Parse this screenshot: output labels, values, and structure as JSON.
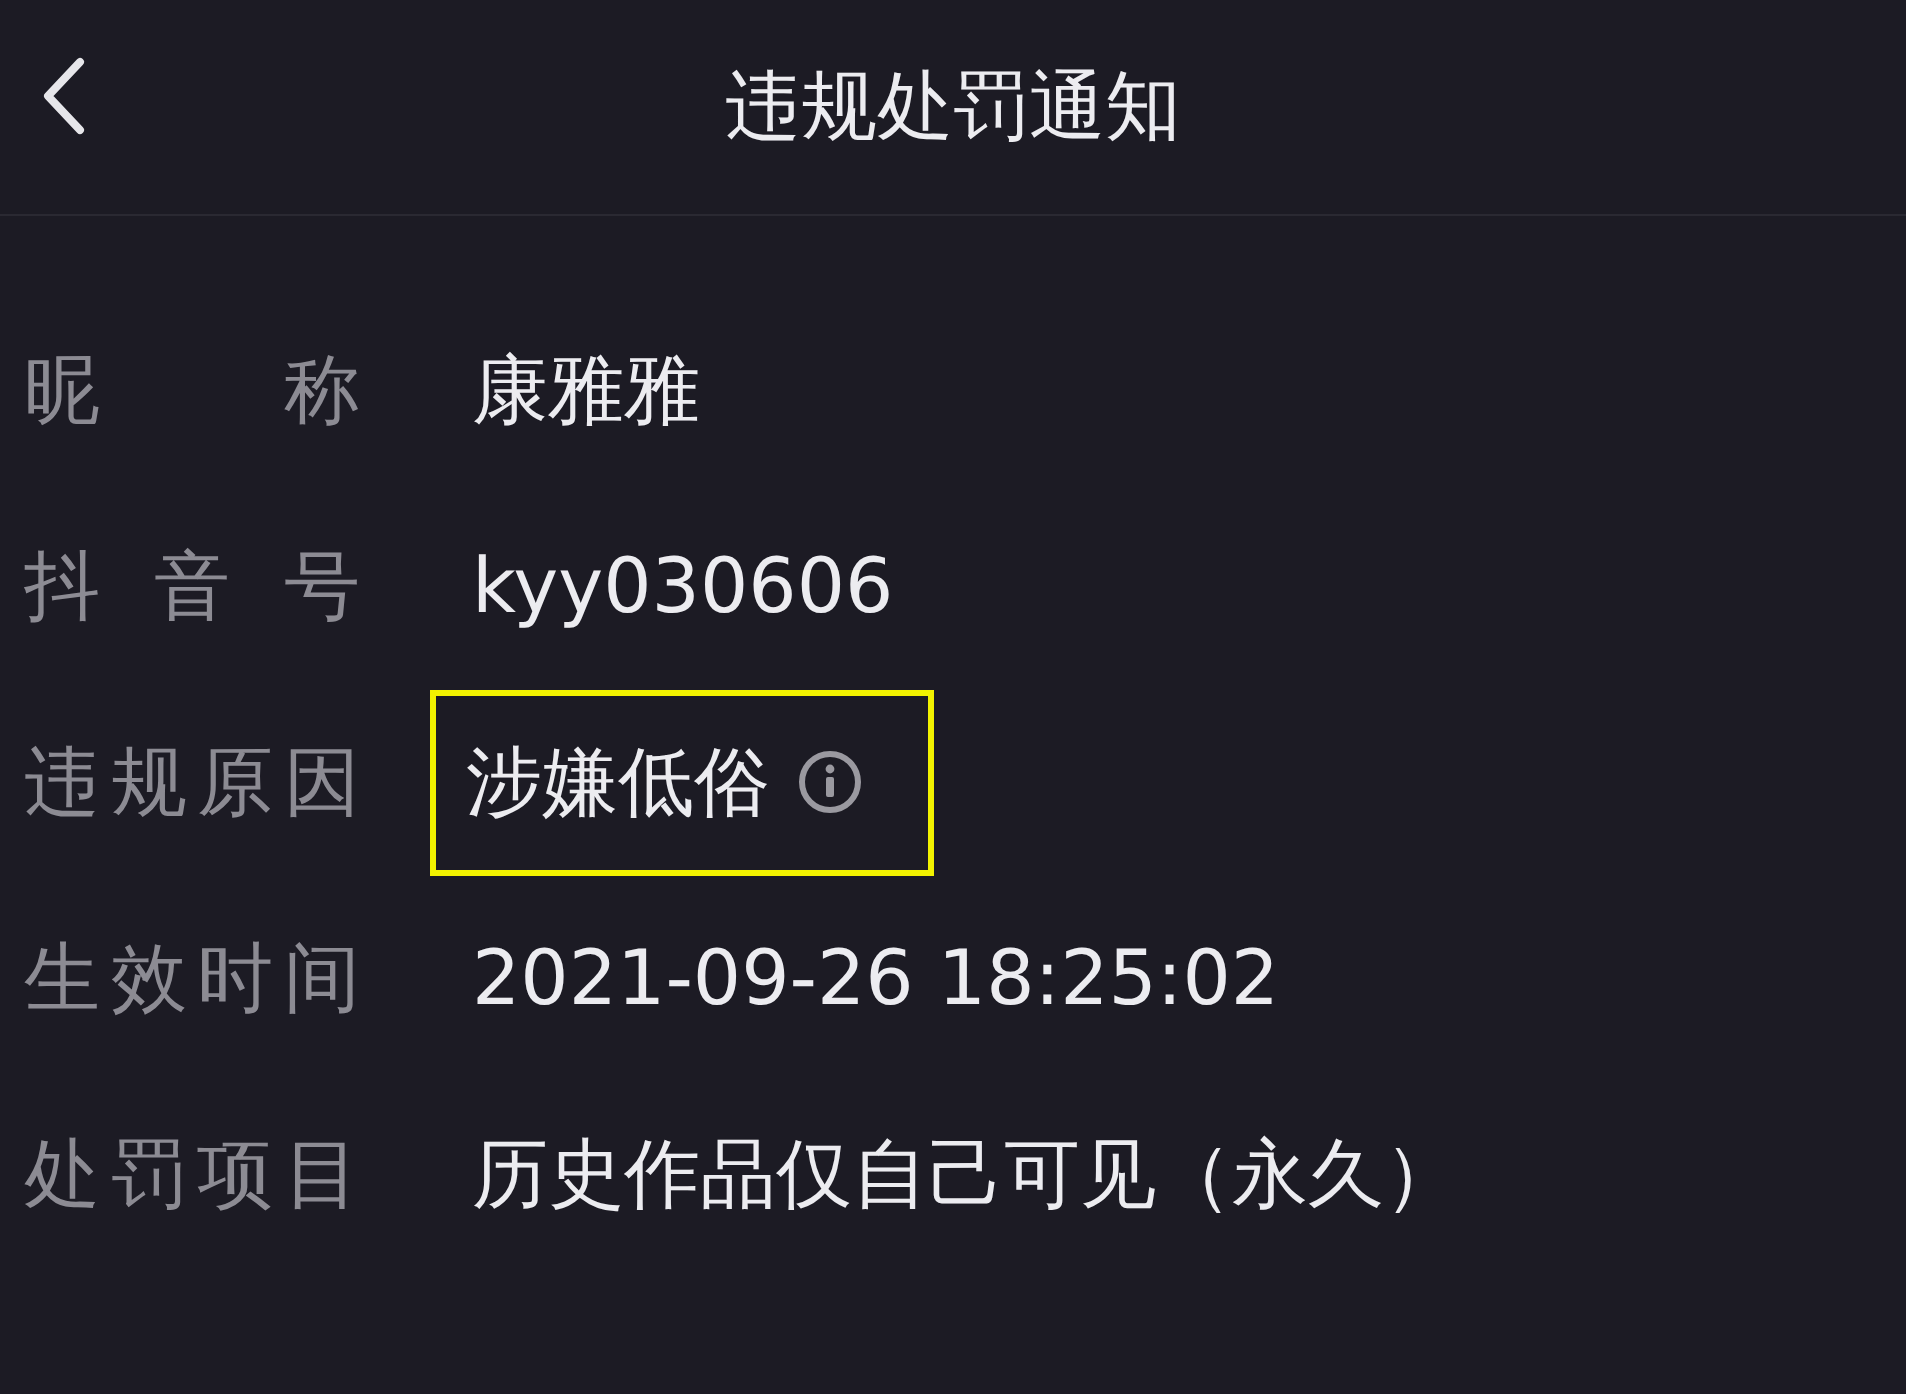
{
  "header": {
    "title": "违规处罚通知"
  },
  "rows": [
    {
      "label": "昵称",
      "value": "康雅雅",
      "info": false,
      "highlighted": false
    },
    {
      "label": "抖音号",
      "value": "kyy030606",
      "info": false,
      "highlighted": false
    },
    {
      "label": "违规原因",
      "value": "涉嫌低俗",
      "info": true,
      "highlighted": true
    },
    {
      "label": "生效时间",
      "value": "2021-09-26 18:25:02",
      "info": false,
      "highlighted": false
    },
    {
      "label": "处罚项目",
      "value": "历史作品仅自己可见（永久）",
      "info": false,
      "highlighted": false
    }
  ]
}
